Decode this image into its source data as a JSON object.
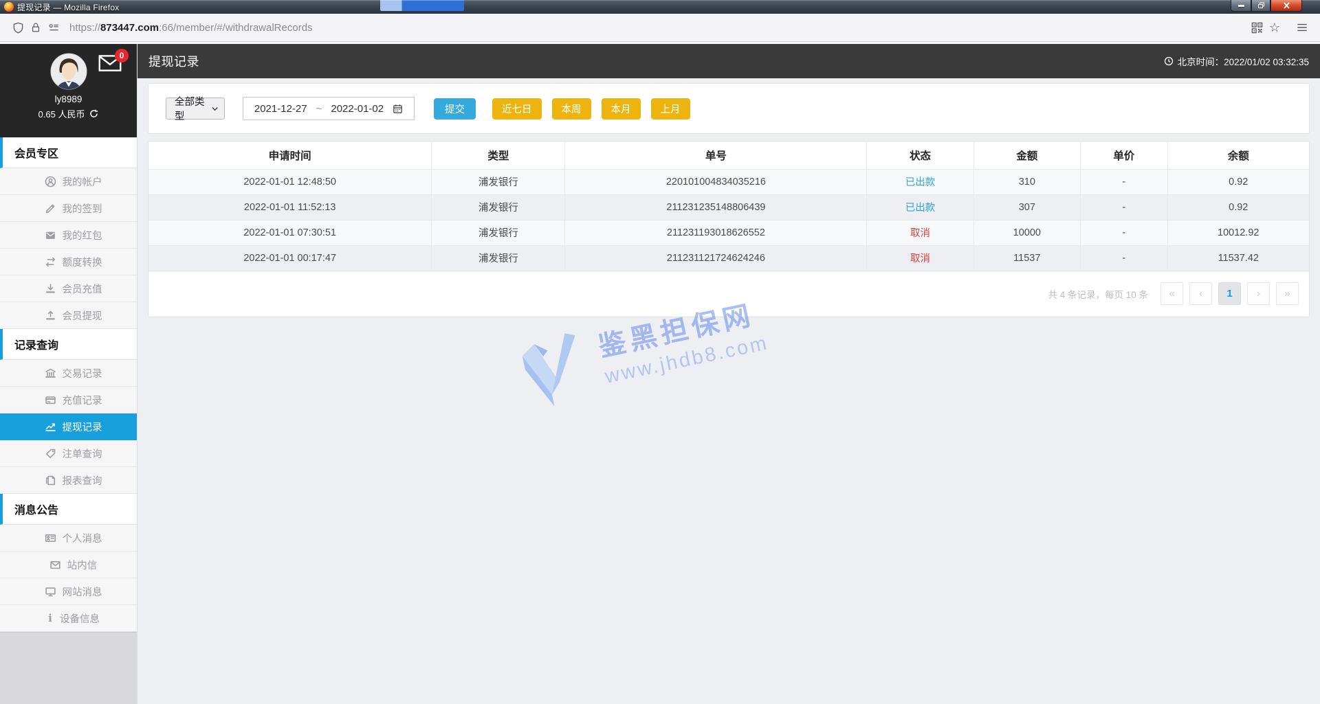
{
  "browser": {
    "window_title": "提现记录 — Mozilla Firefox",
    "url": {
      "prefix": "https://",
      "domain": "873447.com",
      "rest": ":66/member/#/withdrawalRecords"
    }
  },
  "profile": {
    "username": "ly8989",
    "balance": "0.65 人民币",
    "mail_badge": "0"
  },
  "sidebar": {
    "sections": [
      {
        "title": "会员专区",
        "items": [
          "我的帐户",
          "我的签到",
          "我的红包",
          "额度转换",
          "会员充值",
          "会员提现"
        ]
      },
      {
        "title": "记录查询",
        "items": [
          "交易记录",
          "充值记录",
          "提现记录",
          "注单查询",
          "报表查询"
        ]
      },
      {
        "title": "消息公告",
        "items": [
          "个人消息",
          "站内信",
          "网站消息",
          "设备信息"
        ]
      }
    ],
    "active_item": "提现记录"
  },
  "header": {
    "title": "提现记录",
    "beijing_time": "北京时间：2022/01/02 03:32:35"
  },
  "filters": {
    "type_select": "全部类型",
    "date_start": "2021-12-27",
    "date_separator": "~",
    "date_end": "2022-01-02",
    "submit_label": "提交",
    "quick_buttons": [
      "近七日",
      "本周",
      "本月",
      "上月"
    ]
  },
  "table": {
    "columns": [
      "申请时间",
      "类型",
      "单号",
      "状态",
      "金额",
      "单价",
      "余额"
    ],
    "rows": [
      {
        "time": "2022-01-01 12:48:50",
        "type": "浦发银行",
        "order_no": "220101004834035216",
        "status": "已出款",
        "amount": "310",
        "unit_price": "-",
        "balance": "0.92"
      },
      {
        "time": "2022-01-01 11:52:13",
        "type": "浦发银行",
        "order_no": "211231235148806439",
        "status": "已出款",
        "amount": "307",
        "unit_price": "-",
        "balance": "0.92"
      },
      {
        "time": "2022-01-01 07:30:51",
        "type": "浦发银行",
        "order_no": "211231193018626552",
        "status": "取消",
        "amount": "10000",
        "unit_price": "-",
        "balance": "10012.92"
      },
      {
        "time": "2022-01-01 00:17:47",
        "type": "浦发银行",
        "order_no": "211231121724624246",
        "status": "取消",
        "amount": "11537",
        "unit_price": "-",
        "balance": "11537.42"
      }
    ]
  },
  "pagination": {
    "summary": "共 4 条记录，每页 10 条",
    "first": "«",
    "prev": "‹",
    "current_page": "1",
    "next": "›",
    "last": "»"
  },
  "watermark": {
    "site_name": "鉴黑担保网",
    "site_url": "www.jhdb8.com"
  },
  "colors": {
    "accent_blue": "#18a0dd",
    "submit_blue": "#36a9dd",
    "quick_yellow": "#edb30f",
    "status_paid": "#2ba6de",
    "status_cancel": "#e23c3c",
    "badge_red": "#e8262d"
  }
}
